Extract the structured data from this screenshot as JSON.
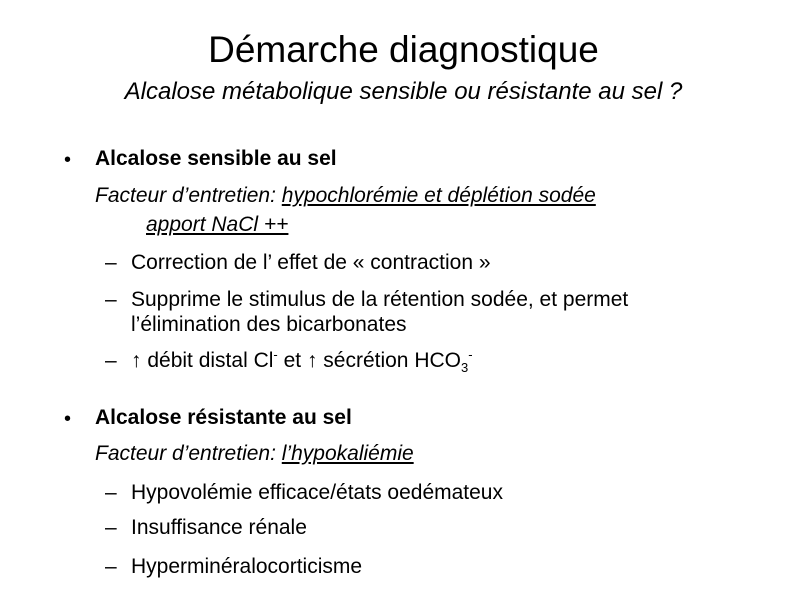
{
  "slide": {
    "title": "Démarche diagnostique",
    "subtitle": "Alcalose métabolique sensible ou résistante au sel ?"
  },
  "sections": [
    {
      "bullet": "•",
      "heading": "Alcalose sensible au sel",
      "factor_label": "Facteur d’entretien: ",
      "factor_value": "hypochlorémie et déplétion sodée",
      "treatment": "apport NaCl ++",
      "items": [
        {
          "dash": "–",
          "text": "Correction de l’ effet de « contraction »"
        },
        {
          "dash": "–",
          "line1": "Supprime le stimulus de la rétention sodée, et permet",
          "line2": "l’élimination des bicarbonates"
        },
        {
          "dash": "–",
          "arrow1": "↑",
          "part1": " débit distal Cl",
          "sup1": "-",
          "part2": " et ",
          "arrow2": "↑",
          "part3": " sécrétion HCO",
          "sub": "3",
          "sup2": "-"
        }
      ]
    },
    {
      "bullet": "•",
      "heading": "Alcalose résistante au sel",
      "factor_label": "Facteur d’entretien: ",
      "factor_value": "l’hypokaliémie",
      "items": [
        {
          "dash": "–",
          "text": "Hypovolémie efficace/états oedémateux"
        },
        {
          "dash": "–",
          "text": "Insuffisance rénale"
        },
        {
          "dash": "–",
          "text": "Hyperminéralocorticisme"
        }
      ]
    }
  ]
}
